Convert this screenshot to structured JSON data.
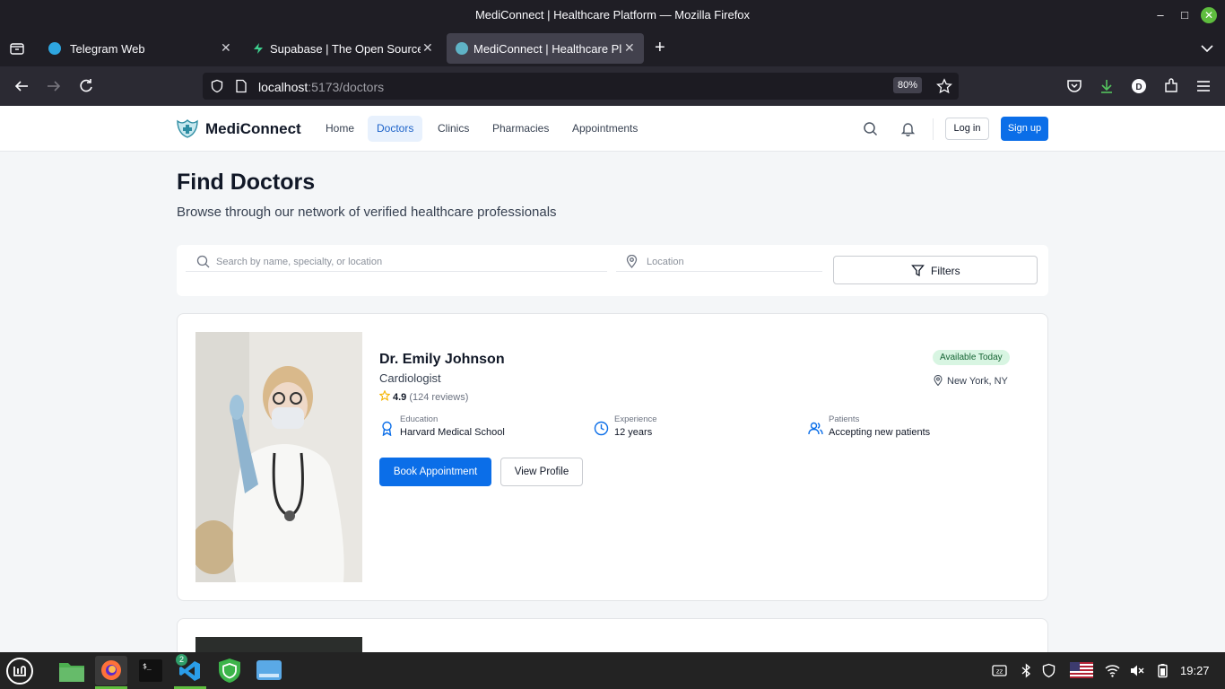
{
  "window": {
    "title": "MediConnect | Healthcare Platform — Mozilla Firefox"
  },
  "tabs": [
    {
      "label": "Telegram Web",
      "active": false
    },
    {
      "label": "Supabase | The Open Source",
      "active": false
    },
    {
      "label": "MediConnect | Healthcare Pl",
      "active": true
    }
  ],
  "address": {
    "host": "localhost",
    "path": ":5173/doctors",
    "zoom": "80%"
  },
  "site": {
    "logo": "MediConnect",
    "nav": [
      "Home",
      "Doctors",
      "Clinics",
      "Pharmacies",
      "Appointments"
    ],
    "active_nav": "Doctors",
    "login": "Log in",
    "signup": "Sign up"
  },
  "page": {
    "title": "Find Doctors",
    "subtitle": "Browse through our network of verified healthcare professionals"
  },
  "search": {
    "placeholder": "Search by name, specialty, or location",
    "location_placeholder": "Location",
    "filters_label": "Filters"
  },
  "doctor": {
    "name": "Dr. Emily Johnson",
    "specialty": "Cardiologist",
    "rating": "4.9",
    "reviews": "(124 reviews)",
    "availability": "Available Today",
    "location": "New York, NY",
    "education_label": "Education",
    "education": "Harvard Medical School",
    "experience_label": "Experience",
    "experience": "12 years",
    "patients_label": "Patients",
    "patients": "Accepting new patients",
    "book_label": "Book Appointment",
    "view_label": "View Profile"
  },
  "taskbar": {
    "clock": "19:27",
    "vscode_badge": "2"
  },
  "icons": {
    "accent": "#0b6ee8",
    "available_bg": "#d8f5e2",
    "star": "#f5b400"
  }
}
